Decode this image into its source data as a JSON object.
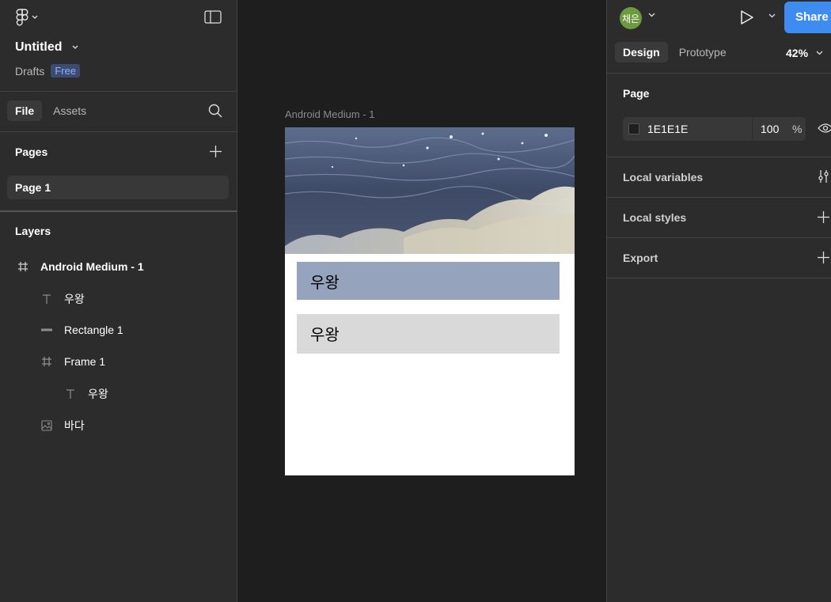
{
  "left": {
    "file_title": "Untitled",
    "drafts": "Drafts",
    "plan_badge": "Free",
    "tabs": [
      "File",
      "Assets"
    ],
    "pages_header": "Pages",
    "pages": [
      "Page 1"
    ],
    "layers_header": "Layers",
    "layers": [
      {
        "name": "Android Medium - 1",
        "icon": "frame-icon",
        "depth": 0
      },
      {
        "name": "우왕",
        "icon": "text-icon",
        "depth": 1
      },
      {
        "name": "Rectangle 1",
        "icon": "rectangle-icon",
        "depth": 1
      },
      {
        "name": "Frame 1",
        "icon": "frame-icon",
        "depth": 1
      },
      {
        "name": "우왕",
        "icon": "text-icon",
        "depth": 2
      },
      {
        "name": "바다",
        "icon": "image-icon",
        "depth": 1
      }
    ]
  },
  "canvas": {
    "frame_label": "Android Medium - 1",
    "text_1": "우왕",
    "text_2": "우왕",
    "box1_color": "#96a3bd",
    "box2_color": "#d9d9d9"
  },
  "right": {
    "avatar_text": "채은",
    "share_label": "Share",
    "tabs": [
      "Design",
      "Prototype"
    ],
    "zoom": "42%",
    "page_header": "Page",
    "bg_hex": "1E1E1E",
    "bg_opacity": "100",
    "pct": "%",
    "local_variables": "Local variables",
    "local_styles": "Local styles",
    "export": "Export"
  },
  "colors": {
    "accent": "#3f8cf0",
    "panel": "#2c2c2c",
    "canvas": "#1e1e1e",
    "avatar": "#6d9a3f"
  }
}
